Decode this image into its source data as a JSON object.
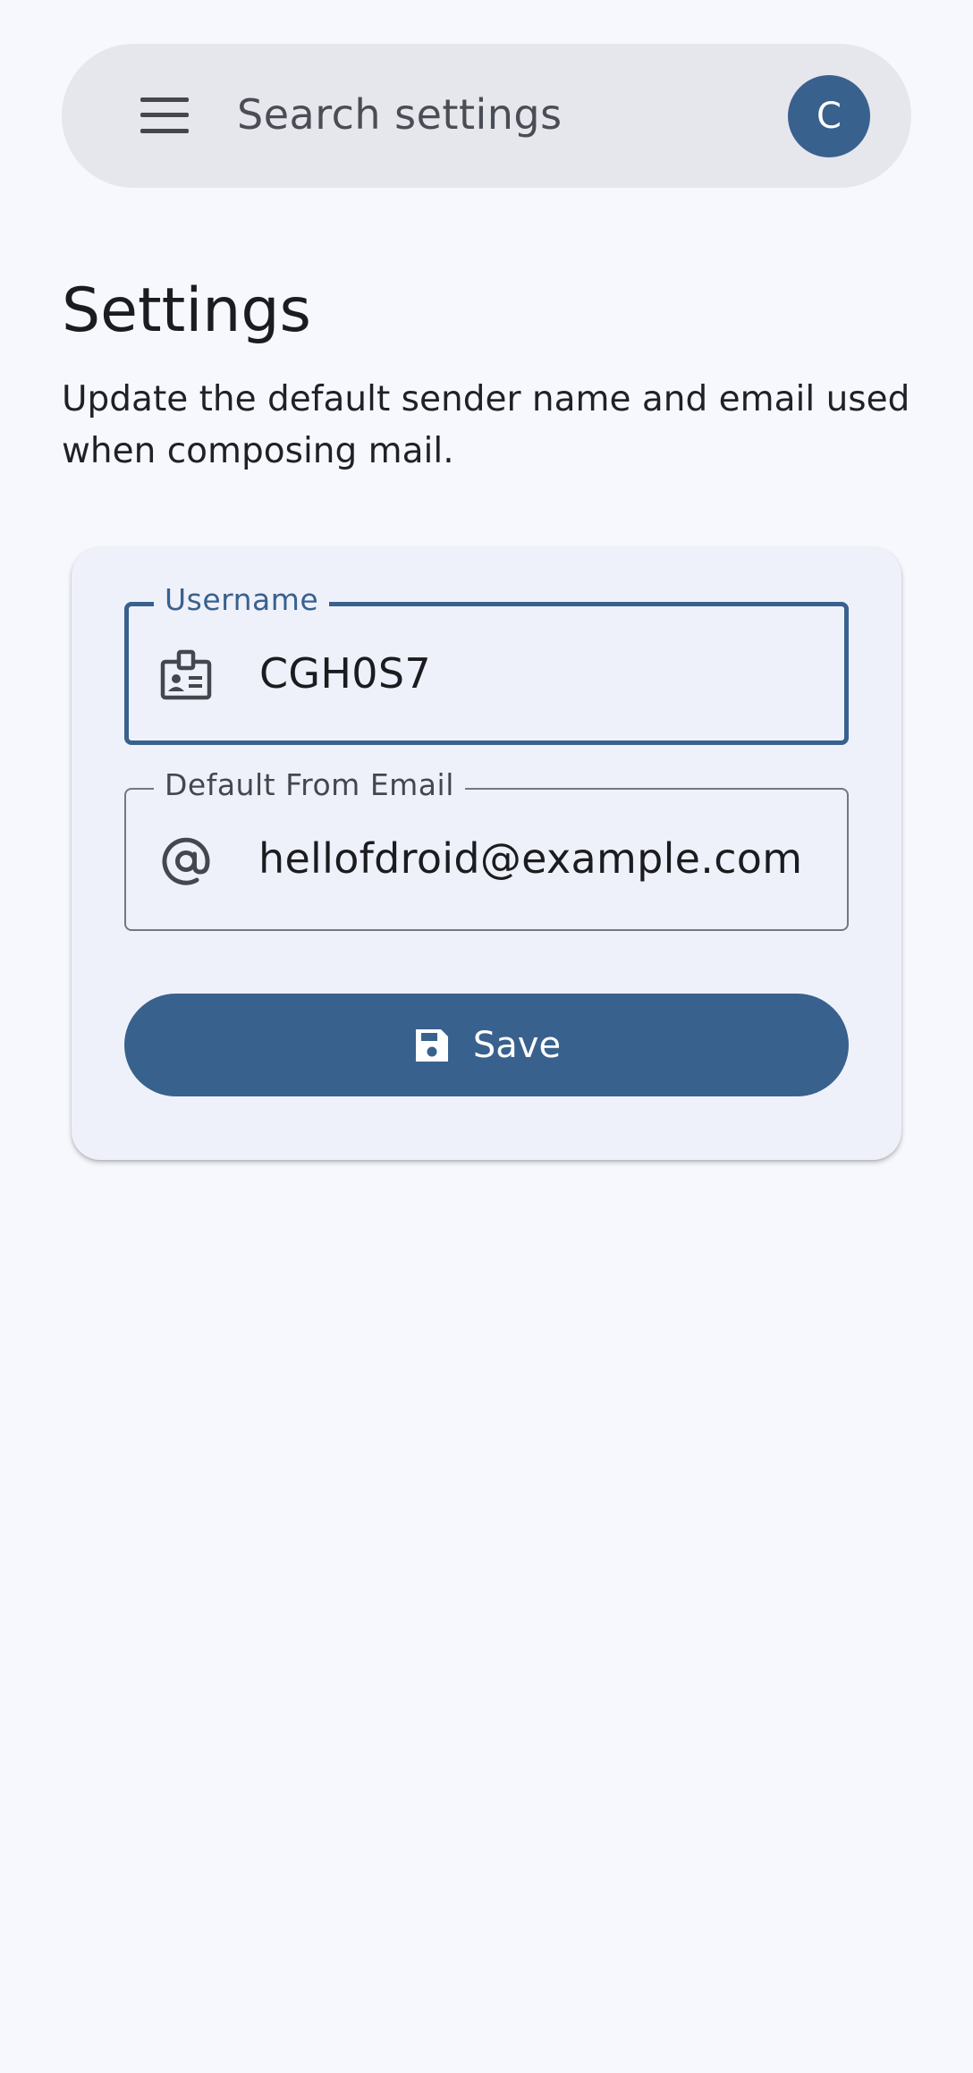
{
  "search": {
    "placeholder": "Search settings"
  },
  "account": {
    "avatar_initial": "C"
  },
  "page": {
    "title": "Settings",
    "description": "Update the default sender name and email used when composing mail."
  },
  "form": {
    "username": {
      "label": "Username",
      "value": "CGH0S7",
      "icon": "badge-icon"
    },
    "email": {
      "label": "Default From Email",
      "value": "hellofdroid@example.com",
      "icon": "at-sign-icon"
    },
    "save_button": {
      "label": "Save",
      "icon": "save-icon"
    }
  },
  "colors": {
    "background": "#f7f8fd",
    "primary": "#39618e",
    "card": "#eff1fa",
    "search_bar": "#e6e7ec"
  }
}
